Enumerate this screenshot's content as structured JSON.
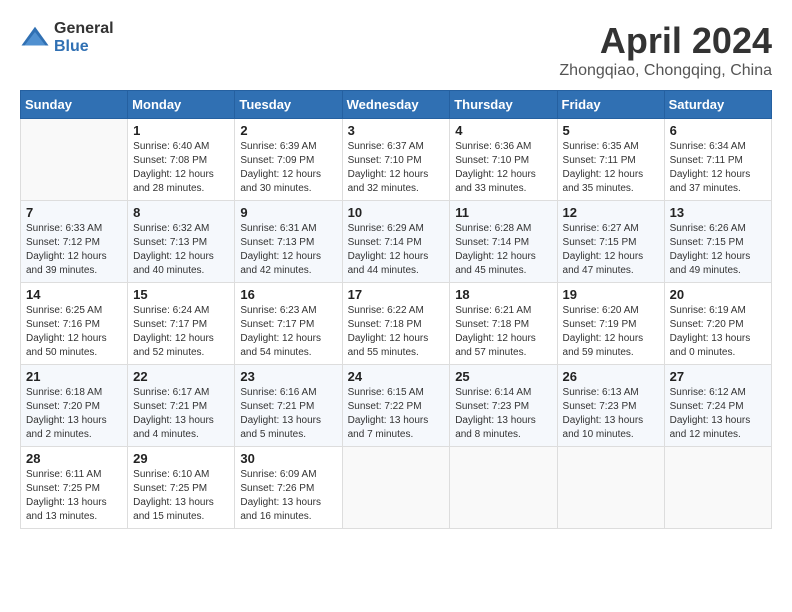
{
  "header": {
    "logo_general": "General",
    "logo_blue": "Blue",
    "month": "April 2024",
    "location": "Zhongqiao, Chongqing, China"
  },
  "weekdays": [
    "Sunday",
    "Monday",
    "Tuesday",
    "Wednesday",
    "Thursday",
    "Friday",
    "Saturday"
  ],
  "weeks": [
    [
      {
        "day": "",
        "info": ""
      },
      {
        "day": "1",
        "info": "Sunrise: 6:40 AM\nSunset: 7:08 PM\nDaylight: 12 hours\nand 28 minutes."
      },
      {
        "day": "2",
        "info": "Sunrise: 6:39 AM\nSunset: 7:09 PM\nDaylight: 12 hours\nand 30 minutes."
      },
      {
        "day": "3",
        "info": "Sunrise: 6:37 AM\nSunset: 7:10 PM\nDaylight: 12 hours\nand 32 minutes."
      },
      {
        "day": "4",
        "info": "Sunrise: 6:36 AM\nSunset: 7:10 PM\nDaylight: 12 hours\nand 33 minutes."
      },
      {
        "day": "5",
        "info": "Sunrise: 6:35 AM\nSunset: 7:11 PM\nDaylight: 12 hours\nand 35 minutes."
      },
      {
        "day": "6",
        "info": "Sunrise: 6:34 AM\nSunset: 7:11 PM\nDaylight: 12 hours\nand 37 minutes."
      }
    ],
    [
      {
        "day": "7",
        "info": "Sunrise: 6:33 AM\nSunset: 7:12 PM\nDaylight: 12 hours\nand 39 minutes."
      },
      {
        "day": "8",
        "info": "Sunrise: 6:32 AM\nSunset: 7:13 PM\nDaylight: 12 hours\nand 40 minutes."
      },
      {
        "day": "9",
        "info": "Sunrise: 6:31 AM\nSunset: 7:13 PM\nDaylight: 12 hours\nand 42 minutes."
      },
      {
        "day": "10",
        "info": "Sunrise: 6:29 AM\nSunset: 7:14 PM\nDaylight: 12 hours\nand 44 minutes."
      },
      {
        "day": "11",
        "info": "Sunrise: 6:28 AM\nSunset: 7:14 PM\nDaylight: 12 hours\nand 45 minutes."
      },
      {
        "day": "12",
        "info": "Sunrise: 6:27 AM\nSunset: 7:15 PM\nDaylight: 12 hours\nand 47 minutes."
      },
      {
        "day": "13",
        "info": "Sunrise: 6:26 AM\nSunset: 7:15 PM\nDaylight: 12 hours\nand 49 minutes."
      }
    ],
    [
      {
        "day": "14",
        "info": "Sunrise: 6:25 AM\nSunset: 7:16 PM\nDaylight: 12 hours\nand 50 minutes."
      },
      {
        "day": "15",
        "info": "Sunrise: 6:24 AM\nSunset: 7:17 PM\nDaylight: 12 hours\nand 52 minutes."
      },
      {
        "day": "16",
        "info": "Sunrise: 6:23 AM\nSunset: 7:17 PM\nDaylight: 12 hours\nand 54 minutes."
      },
      {
        "day": "17",
        "info": "Sunrise: 6:22 AM\nSunset: 7:18 PM\nDaylight: 12 hours\nand 55 minutes."
      },
      {
        "day": "18",
        "info": "Sunrise: 6:21 AM\nSunset: 7:18 PM\nDaylight: 12 hours\nand 57 minutes."
      },
      {
        "day": "19",
        "info": "Sunrise: 6:20 AM\nSunset: 7:19 PM\nDaylight: 12 hours\nand 59 minutes."
      },
      {
        "day": "20",
        "info": "Sunrise: 6:19 AM\nSunset: 7:20 PM\nDaylight: 13 hours\nand 0 minutes."
      }
    ],
    [
      {
        "day": "21",
        "info": "Sunrise: 6:18 AM\nSunset: 7:20 PM\nDaylight: 13 hours\nand 2 minutes."
      },
      {
        "day": "22",
        "info": "Sunrise: 6:17 AM\nSunset: 7:21 PM\nDaylight: 13 hours\nand 4 minutes."
      },
      {
        "day": "23",
        "info": "Sunrise: 6:16 AM\nSunset: 7:21 PM\nDaylight: 13 hours\nand 5 minutes."
      },
      {
        "day": "24",
        "info": "Sunrise: 6:15 AM\nSunset: 7:22 PM\nDaylight: 13 hours\nand 7 minutes."
      },
      {
        "day": "25",
        "info": "Sunrise: 6:14 AM\nSunset: 7:23 PM\nDaylight: 13 hours\nand 8 minutes."
      },
      {
        "day": "26",
        "info": "Sunrise: 6:13 AM\nSunset: 7:23 PM\nDaylight: 13 hours\nand 10 minutes."
      },
      {
        "day": "27",
        "info": "Sunrise: 6:12 AM\nSunset: 7:24 PM\nDaylight: 13 hours\nand 12 minutes."
      }
    ],
    [
      {
        "day": "28",
        "info": "Sunrise: 6:11 AM\nSunset: 7:25 PM\nDaylight: 13 hours\nand 13 minutes."
      },
      {
        "day": "29",
        "info": "Sunrise: 6:10 AM\nSunset: 7:25 PM\nDaylight: 13 hours\nand 15 minutes."
      },
      {
        "day": "30",
        "info": "Sunrise: 6:09 AM\nSunset: 7:26 PM\nDaylight: 13 hours\nand 16 minutes."
      },
      {
        "day": "",
        "info": ""
      },
      {
        "day": "",
        "info": ""
      },
      {
        "day": "",
        "info": ""
      },
      {
        "day": "",
        "info": ""
      }
    ]
  ]
}
